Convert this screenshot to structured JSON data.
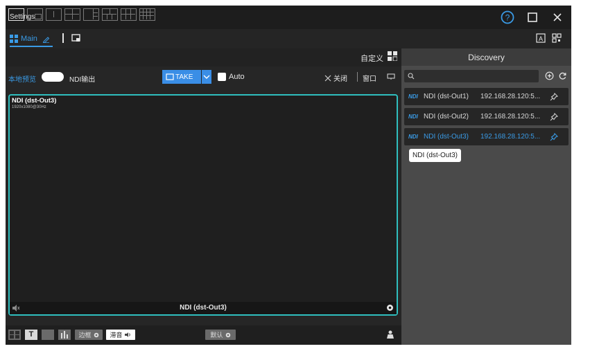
{
  "window": {
    "title": "Settings"
  },
  "toolbar": {
    "main_tab_label": "Main"
  },
  "layout_bar": {
    "custom_label": "自定义"
  },
  "controls": {
    "local_preview_label": "本地预览",
    "ndi_output_label": "NDI输出",
    "take_label": "TAKE",
    "auto_label": "Auto",
    "close_label": "关闭",
    "window_label": "窗口"
  },
  "preview": {
    "source_name": "NDI (dst-Out3)",
    "resolution": "1920x1080@30Hz",
    "footer_name": "NDI (dst-Out3)"
  },
  "bottom": {
    "border_label": "边框",
    "mute_label": "滞音",
    "default_label": "默认"
  },
  "discovery": {
    "header": "Discovery",
    "search_placeholder": "",
    "sources": [
      {
        "logo": "NDI",
        "name": "NDI (dst-Out1)",
        "ip": "192.168.28.120:5..."
      },
      {
        "logo": "NDI",
        "name": "NDI (dst-Out2)",
        "ip": "192.168.28.120:5..."
      },
      {
        "logo": "NDI",
        "name": "NDI (dst-Out3)",
        "ip": "192.168.28.120:5..."
      }
    ],
    "tooltip": "NDI (dst-Out3)"
  },
  "colors": {
    "accent": "#3a9be6",
    "preview_border": "#2fbfbf",
    "window_bg": "#2b2b2b"
  }
}
